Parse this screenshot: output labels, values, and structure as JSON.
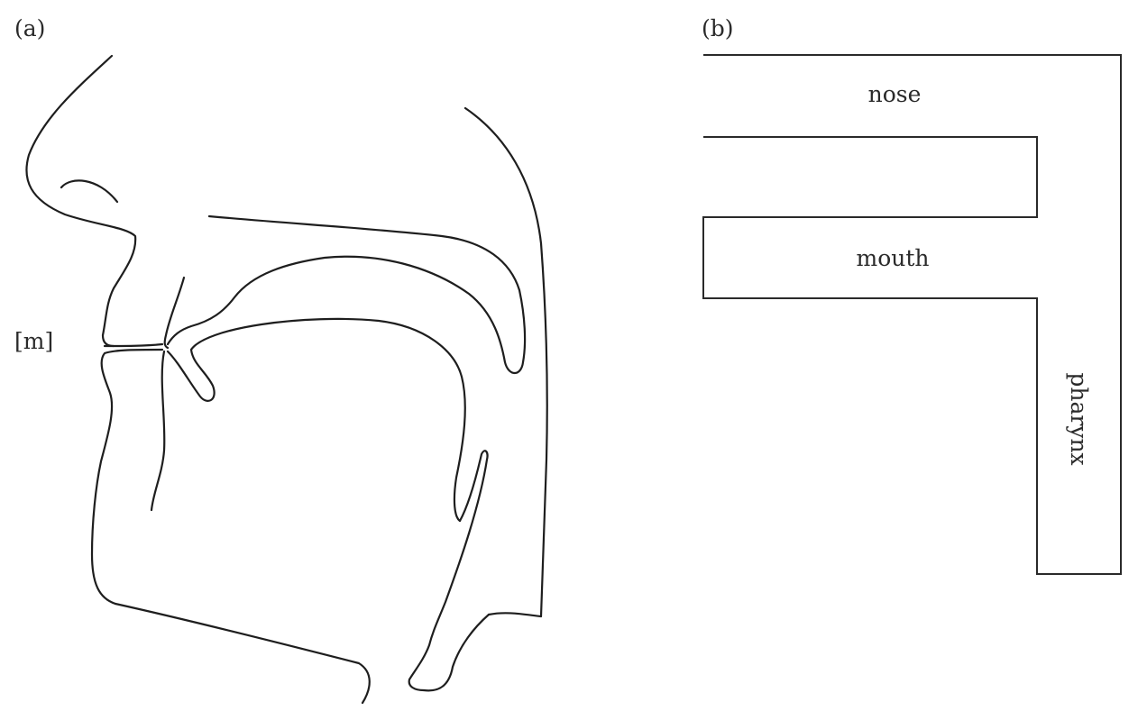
{
  "panels": {
    "a": {
      "label": "(a)",
      "sound_label": "[m]"
    },
    "b": {
      "label": "(b)",
      "region_labels": {
        "nose": "nose",
        "mouth": "mouth",
        "pharynx": "pharynx"
      }
    }
  },
  "colors": {
    "line": "#1e1e1e",
    "background": "#ffffff"
  }
}
